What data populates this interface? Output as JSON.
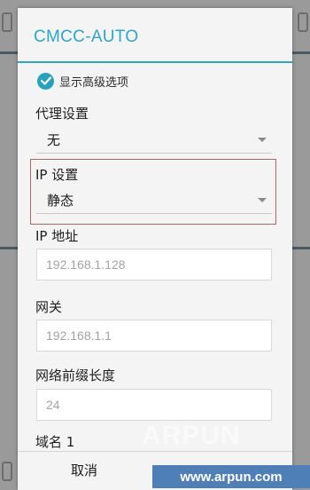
{
  "dialog": {
    "title": "CMCC-AUTO",
    "advanced_option_label": "显示高级选项",
    "proxy": {
      "label": "代理设置",
      "value": "无"
    },
    "ip_settings": {
      "label": "IP 设置",
      "value": "静态"
    },
    "ip_address": {
      "label": "IP 地址",
      "placeholder": "192.168.1.128"
    },
    "gateway": {
      "label": "网关",
      "placeholder": "192.168.1.1"
    },
    "prefix_length": {
      "label": "网络前缀长度",
      "placeholder": "24"
    },
    "dns1_label": "域名 1",
    "cancel_label": "取消"
  },
  "watermark": {
    "text": "ARPUN",
    "url": "www.arpun.com"
  },
  "colors": {
    "accent": "#2aa8c8",
    "highlight_border": "#a8695f",
    "watermark_bg": "#4f7fb7"
  }
}
